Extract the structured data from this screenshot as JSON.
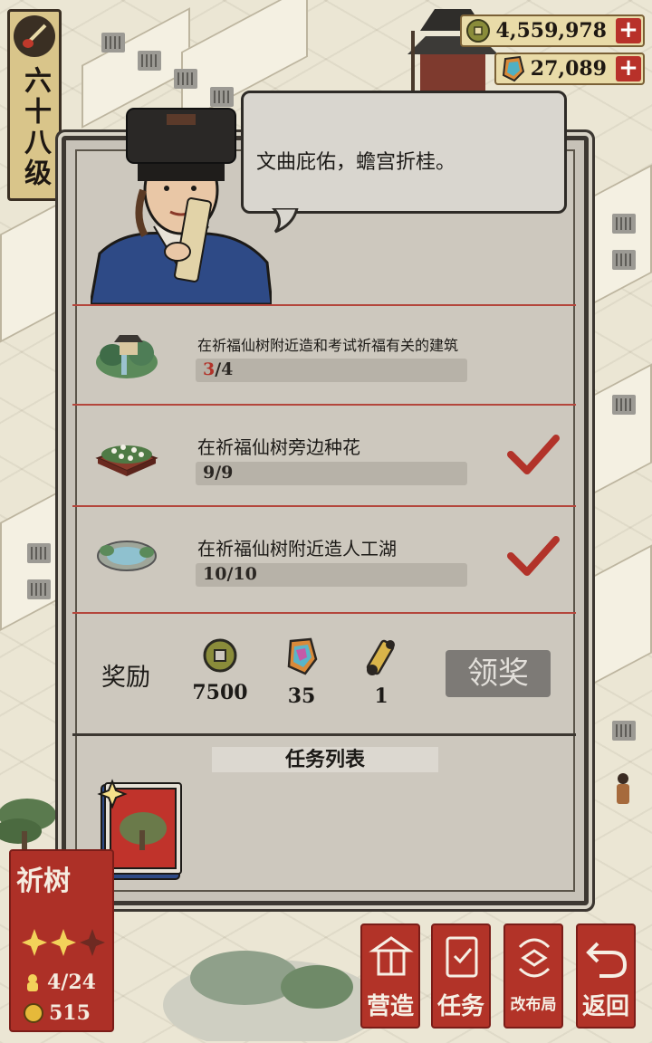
{
  "player": {
    "level": "六十八级"
  },
  "currency": {
    "coins": "4,559,978",
    "jade": "27,089"
  },
  "dialog": {
    "speech": "文曲庇佑，蟾宫折桂。"
  },
  "quests": [
    {
      "title": "在祈福仙树附近造和考试祈福有关的建筑",
      "progress_current": "3",
      "progress_total": "/4",
      "done": false,
      "icon": "pavilion-icon"
    },
    {
      "title": "在祈福仙树旁边种花",
      "progress": "9/9",
      "done": true,
      "icon": "flower-bed-icon"
    },
    {
      "title": "在祈福仙树附近造人工湖",
      "progress": "10/10",
      "done": true,
      "icon": "lake-icon"
    }
  ],
  "reward": {
    "label": "奖励",
    "items": [
      {
        "icon": "copper-coin-icon",
        "value": "7500"
      },
      {
        "icon": "jade-gem-icon",
        "value": "35"
      },
      {
        "icon": "scroll-icon",
        "value": "1"
      }
    ],
    "claim_label": "领奖"
  },
  "task_list": {
    "title": "任务列表"
  },
  "tree_card": {
    "title": "祈树",
    "count": "4/24",
    "coins": "515",
    "stars_filled": 2,
    "stars_total": 3
  },
  "nav": [
    {
      "label": "营造",
      "icon": "build-icon"
    },
    {
      "label": "任务",
      "icon": "task-book-icon"
    },
    {
      "label": "改布局",
      "icon": "layout-icon"
    },
    {
      "label": "返回",
      "icon": "back-arrow-icon"
    }
  ],
  "colors": {
    "accent_red": "#b23328",
    "panel_bg": "#c7c2b8",
    "progress_red": "#b2332a"
  }
}
